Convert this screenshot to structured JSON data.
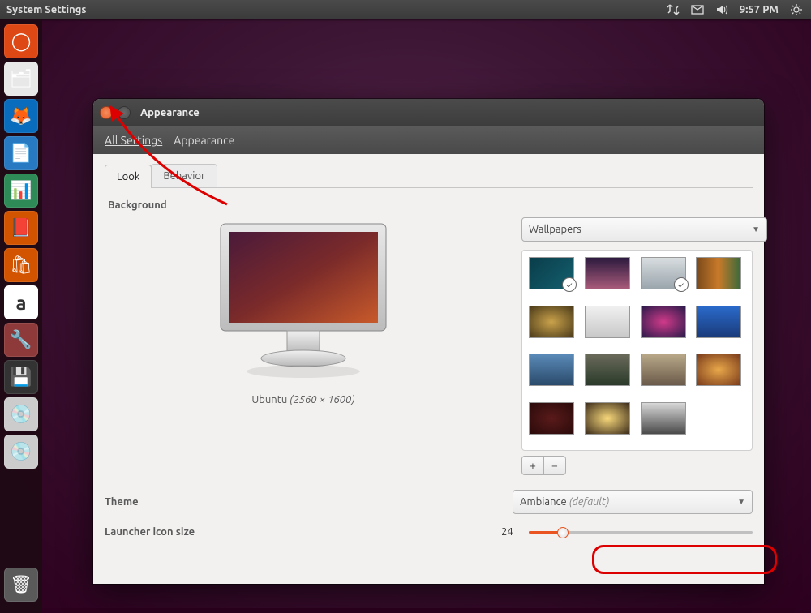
{
  "topbar": {
    "title": "System Settings",
    "time": "9:57 PM"
  },
  "launcher_items": [
    {
      "name": "dash",
      "bg": "#dd4814",
      "glyph": "◯"
    },
    {
      "name": "files",
      "bg": "#e8e8e8",
      "glyph": "🗂"
    },
    {
      "name": "firefox",
      "bg": "#0a6cbc",
      "glyph": "🦊"
    },
    {
      "name": "writer",
      "bg": "#277ac1",
      "glyph": "📄"
    },
    {
      "name": "calc",
      "bg": "#2e8b57",
      "glyph": "📊"
    },
    {
      "name": "impress",
      "bg": "#d35400",
      "glyph": "📕"
    },
    {
      "name": "software",
      "bg": "#d35400",
      "glyph": "🛍"
    },
    {
      "name": "amazon",
      "bg": "#ffffff",
      "glyph": "a"
    },
    {
      "name": "settings",
      "bg": "#8e3a3a",
      "glyph": "🔧"
    },
    {
      "name": "media",
      "bg": "#333333",
      "glyph": "💾"
    },
    {
      "name": "disc1",
      "bg": "#cccccc",
      "glyph": "💿"
    },
    {
      "name": "disc2",
      "bg": "#cccccc",
      "glyph": "💿"
    }
  ],
  "window": {
    "title": "Appearance",
    "breadcrumb": [
      "All Settings",
      "Appearance"
    ],
    "tabs": [
      "Look",
      "Behavior"
    ],
    "active_tab": 0,
    "background_label": "Background",
    "preview_caption_name": "Ubuntu",
    "preview_caption_res": "(2560 × 1600)",
    "wallpaper_source": "Wallpapers",
    "theme_label": "Theme",
    "theme_value": "Ambiance",
    "theme_suffix": "(default)",
    "launcher_label": "Launcher icon size",
    "launcher_value": "24"
  },
  "thumbs": [
    {
      "bg": "linear-gradient(135deg,#0a3d4a,#145f6e)",
      "checked": true
    },
    {
      "bg": "linear-gradient(180deg,#2c1a3e,#a85a7a)",
      "checked": false
    },
    {
      "bg": "linear-gradient(180deg,#d8dde0,#9aa5ac)",
      "checked": true
    },
    {
      "bg": "linear-gradient(90deg,#7a4a1a,#c87a2a,#3a6a3a)",
      "checked": false
    },
    {
      "bg": "radial-gradient(#caa24a,#4a3a1a)",
      "checked": false
    },
    {
      "bg": "linear-gradient(180deg,#f0f0f0,#c8c8c8)",
      "checked": false
    },
    {
      "bg": "radial-gradient(#d03a8a,#2a1a4a)",
      "checked": false
    },
    {
      "bg": "linear-gradient(180deg,#2a6aca,#1a3a7a)",
      "checked": false
    },
    {
      "bg": "linear-gradient(180deg,#5a8ab8,#2a4a6a)",
      "checked": false
    },
    {
      "bg": "linear-gradient(180deg,#6a6a5a,#2a3a2a)",
      "checked": false
    },
    {
      "bg": "linear-gradient(180deg,#b8a888,#6a5a4a)",
      "checked": false
    },
    {
      "bg": "radial-gradient(#e8a84a,#7a3a1a)",
      "checked": false
    },
    {
      "bg": "radial-gradient(#5a1a1a,#2a0a0a)",
      "checked": false
    },
    {
      "bg": "radial-gradient(#f8d87a,#3a2a1a)",
      "checked": false
    },
    {
      "bg": "linear-gradient(180deg,#d8d8d8,#4a4a4a)",
      "checked": false
    }
  ]
}
